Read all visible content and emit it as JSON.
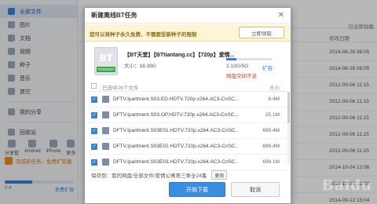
{
  "sidebar": {
    "items": [
      {
        "label": "全部文件",
        "icon": "all-files-icon"
      },
      {
        "label": "图片",
        "icon": "image-icon"
      },
      {
        "label": "文档",
        "icon": "document-icon"
      },
      {
        "label": "视频",
        "icon": "video-icon"
      },
      {
        "label": "种子",
        "icon": "bt-icon"
      },
      {
        "label": "音乐",
        "icon": "music-icon"
      },
      {
        "label": "其它",
        "icon": "other-icon"
      },
      {
        "label": "我的分享",
        "icon": "share-icon"
      },
      {
        "label": "回收站",
        "icon": "trash-icon"
      }
    ],
    "devices": [
      "分享管",
      "Android",
      "iPhone",
      "更多"
    ],
    "promo": "完成新任务，免费扩容量",
    "quota_used": "0.4",
    "quota_cta": "免费扩容"
  },
  "main": {
    "topbar_right": "已全部加载",
    "col_time": "修改日期",
    "times": [
      "2014-08-26 08:05",
      "2014-08-26 08:05",
      "2012-09-06 11:15",
      "2012-09-06 11:15",
      "2012-09-06 11:15",
      "2012-09-06 11:15",
      "2012-09-06 11:15",
      "2014-10-24 12:06",
      "2014-10-13 12:08",
      "2014-09-12 15:04"
    ]
  },
  "dialog": {
    "title": "新建离线BT任务",
    "notice": "您可以将种子永久免费，不需要受新种子的限制",
    "notice_button": "立即领取",
    "torrent_icon_text": "BT",
    "torrent_icon_tag": "TORRENT",
    "torrent_name": "【BT天堂】【BTtiantang.cc】【720p】爱情...",
    "torrent_size": "大小：16.39G",
    "space_value": "1.13G/5G",
    "space_fraction": 0.226,
    "space_link": "扩容",
    "space_warning": "网盘空间不足",
    "list_header_label": "已选中26个文件",
    "list_header_size": "大小",
    "files": [
      {
        "name": "DFTV.Ipartment.S03.ED.HDTV.720p.x264.AC3-CnSC...",
        "size": "8.4M"
      },
      {
        "name": "DFTV.Ipartment.S03.OP.HDTV.720p.x264.AC3-CnSC...",
        "size": "25.1M"
      },
      {
        "name": "DFTV.Ipartment.S03E01.HDTV.720p.x264.AC3-CnSC...",
        "size": "699.4M"
      },
      {
        "name": "DFTV.Ipartment.S03E02.HDTV.720p.x264.AC3-CnSC...",
        "size": "699.4M"
      },
      {
        "name": "DFTV.Ipartment.S03E03.HDTV.720p.x264.AC3-CnSC...",
        "size": "699.1M"
      }
    ],
    "save_to": "保存到：我的网盘/全部文件/爱情公寓第三季全24集",
    "change_label": "更改",
    "start_button": "开始下载",
    "cancel_button": "取消"
  },
  "watermark": "Baidu"
}
